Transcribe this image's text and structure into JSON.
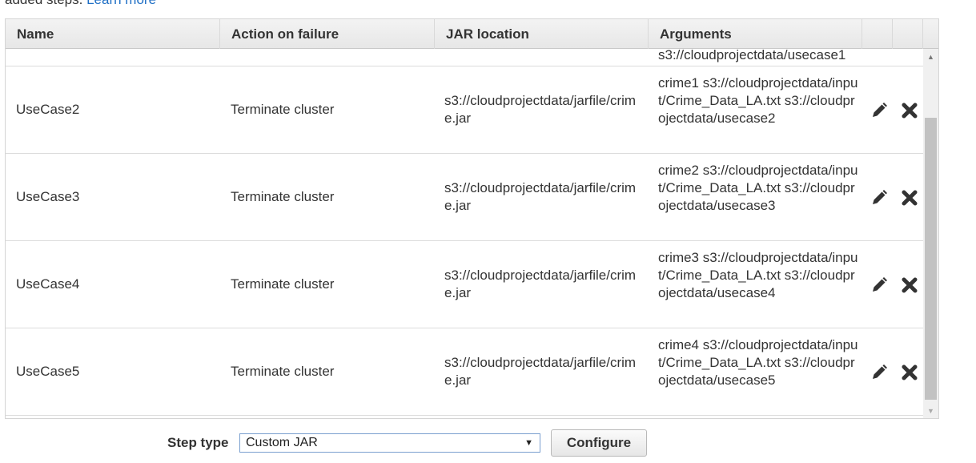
{
  "intro": {
    "text": "added steps.",
    "link": "Learn more"
  },
  "table": {
    "columns": [
      "Name",
      "Action on failure",
      "JAR location",
      "Arguments"
    ],
    "rows": [
      {
        "name": "",
        "action": "",
        "jar": "",
        "args": "s3://cloudprojectdata/usecase1"
      },
      {
        "name": "UseCase2",
        "action": "Terminate cluster",
        "jar": "s3://cloudprojectdata/jarfile/crime.jar",
        "args": "crime1 s3://cloudprojectdata/input/Crime_Data_LA.txt s3://cloudprojectdata/usecase2"
      },
      {
        "name": "UseCase3",
        "action": "Terminate cluster",
        "jar": "s3://cloudprojectdata/jarfile/crime.jar",
        "args": "crime2 s3://cloudprojectdata/input/Crime_Data_LA.txt s3://cloudprojectdata/usecase3"
      },
      {
        "name": "UseCase4",
        "action": "Terminate cluster",
        "jar": "s3://cloudprojectdata/jarfile/crime.jar",
        "args": "crime3 s3://cloudprojectdata/input/Crime_Data_LA.txt s3://cloudprojectdata/usecase4"
      },
      {
        "name": "UseCase5",
        "action": "Terminate cluster",
        "jar": "s3://cloudprojectdata/jarfile/crime.jar",
        "args": "crime4 s3://cloudprojectdata/input/Crime_Data_LA.txt s3://cloudprojectdata/usecase5"
      }
    ],
    "row_icons": [
      "pencil-icon",
      "close-x-icon"
    ]
  },
  "footer": {
    "step_type_label": "Step type",
    "step_type_value": "Custom JAR",
    "configure_label": "Configure"
  }
}
